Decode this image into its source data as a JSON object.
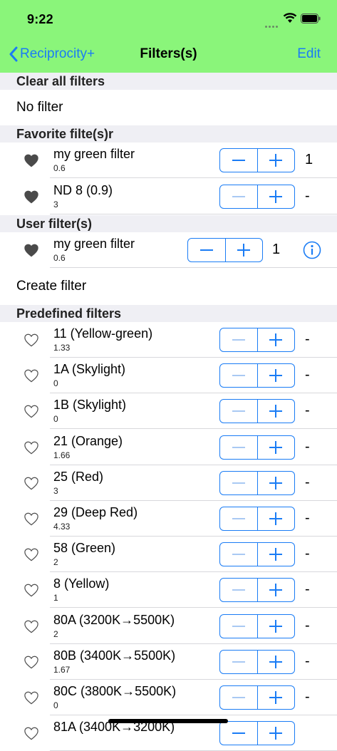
{
  "status": {
    "time": "9:22"
  },
  "nav": {
    "back_label": "Reciprocity+",
    "title": "Filters(s)",
    "edit_label": "Edit"
  },
  "sections": {
    "clear_header": "Clear all filters",
    "no_filter": "No filter",
    "favorites_header": "Favorite filte(s)r",
    "user_header": "User filter(s)",
    "create_filter": "Create filter",
    "predefined_header": "Predefined filters"
  },
  "favorites": [
    {
      "name": "my green filter",
      "value": "0.6",
      "count": "1"
    },
    {
      "name": "ND  8 (0.9)",
      "value": "3",
      "count": "-"
    }
  ],
  "user_filters": [
    {
      "name": "my green filter",
      "value": "0.6",
      "count": "1"
    }
  ],
  "predefined": [
    {
      "name": "11 (Yellow-green)",
      "value": "1.33",
      "count": "-"
    },
    {
      "name": "1A (Skylight)",
      "value": "0",
      "count": "-"
    },
    {
      "name": "1B (Skylight)",
      "value": "0",
      "count": "-"
    },
    {
      "name": "21 (Orange)",
      "value": "1.66",
      "count": "-"
    },
    {
      "name": "25 (Red)",
      "value": "3",
      "count": "-"
    },
    {
      "name": "29 (Deep Red)",
      "value": "4.33",
      "count": "-"
    },
    {
      "name": "58 (Green)",
      "value": "2",
      "count": "-"
    },
    {
      "name": "8 (Yellow)",
      "value": "1",
      "count": "-"
    },
    {
      "name": "80A (3200K→5500K)",
      "value": "2",
      "count": "-"
    },
    {
      "name": "80B (3400K→5500K)",
      "value": "1.67",
      "count": "-"
    },
    {
      "name": "80C (3800K→5500K)",
      "value": "0",
      "count": "-"
    },
    {
      "name": "81A (3400K→3200K)",
      "value": "",
      "count": ""
    }
  ],
  "colors": {
    "accent": "#1a7cf5",
    "bar": "#8af57a",
    "section_bg": "#efeff4"
  }
}
